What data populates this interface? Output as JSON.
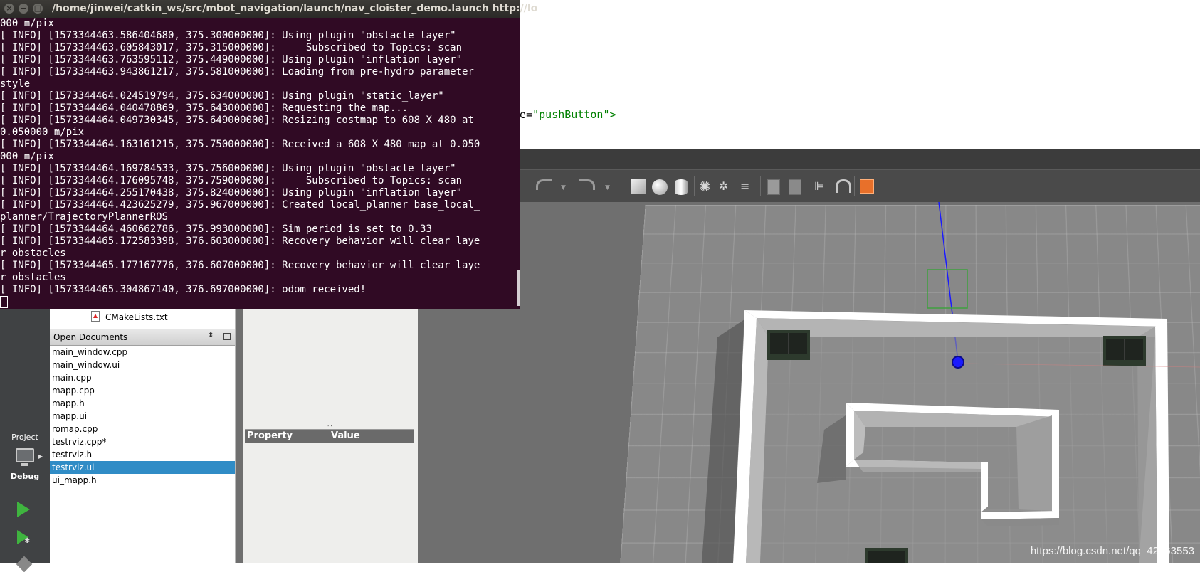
{
  "editor": {
    "code_fragment_attr": "ame=",
    "code_fragment_value": "\"pushButton\">"
  },
  "terminal": {
    "title": "/home/jinwei/catkin_ws/src/mbot_navigation/launch/nav_cloister_demo.launch http://lo",
    "buttons": [
      "×",
      "−",
      "□"
    ],
    "lines": [
      "000 m/pix",
      "[ INFO] [1573344463.586404680, 375.300000000]: Using plugin \"obstacle_layer\"",
      "[ INFO] [1573344463.605843017, 375.315000000]:     Subscribed to Topics: scan",
      "[ INFO] [1573344463.763595112, 375.449000000]: Using plugin \"inflation_layer\"",
      "[ INFO] [1573344463.943861217, 375.581000000]: Loading from pre-hydro parameter",
      "style",
      "[ INFO] [1573344464.024519794, 375.634000000]: Using plugin \"static_layer\"",
      "[ INFO] [1573344464.040478869, 375.643000000]: Requesting the map...",
      "[ INFO] [1573344464.049730345, 375.649000000]: Resizing costmap to 608 X 480 at",
      "0.050000 m/pix",
      "[ INFO] [1573344464.163161215, 375.750000000]: Received a 608 X 480 map at 0.050",
      "000 m/pix",
      "[ INFO] [1573344464.169784533, 375.756000000]: Using plugin \"obstacle_layer\"",
      "[ INFO] [1573344464.176095748, 375.759000000]:     Subscribed to Topics: scan",
      "[ INFO] [1573344464.255170438, 375.824000000]: Using plugin \"inflation_layer\"",
      "[ INFO] [1573344464.423625279, 375.967000000]: Created local_planner base_local_",
      "planner/TrajectoryPlannerROS",
      "[ INFO] [1573344464.460662786, 375.993000000]: Sim period is set to 0.33",
      "[ INFO] [1573344465.172583398, 376.603000000]: Recovery behavior will clear laye",
      "r obstacles",
      "[ INFO] [1573344465.177167776, 376.607000000]: Recovery behavior will clear laye",
      "r obstacles",
      "[ INFO] [1573344465.304867140, 376.697000000]: odom received!"
    ]
  },
  "qtcreator": {
    "project_file": "CMakeLists.txt",
    "open_documents_title": "Open Documents",
    "open_documents": [
      {
        "name": "main_window.cpp",
        "selected": false
      },
      {
        "name": "main_window.ui",
        "selected": false
      },
      {
        "name": "main.cpp",
        "selected": false
      },
      {
        "name": "mapp.cpp",
        "selected": false
      },
      {
        "name": "mapp.h",
        "selected": false
      },
      {
        "name": "mapp.ui",
        "selected": false
      },
      {
        "name": "romap.cpp",
        "selected": false
      },
      {
        "name": "testrviz.cpp*",
        "selected": false
      },
      {
        "name": "testrviz.h",
        "selected": false
      },
      {
        "name": "testrviz.ui",
        "selected": true
      },
      {
        "name": "ui_mapp.h",
        "selected": false
      }
    ],
    "modes": {
      "project": "Project",
      "debug": "Debug"
    },
    "property_editor": {
      "property_header": "Property",
      "value_header": "Value",
      "grip": "'''"
    }
  },
  "gazebo": {
    "toolbar": [
      "undo-icon",
      "redo-icon",
      "box-icon",
      "sphere-icon",
      "cylinder-icon",
      "point-light-icon",
      "spot-light-icon",
      "directional-light-icon",
      "copy-icon",
      "paste-icon",
      "align-icon",
      "snap-icon",
      "view-angle-icon"
    ],
    "accent_color": "#e8702a"
  },
  "watermark": "https://blog.csdn.net/qq_42263553"
}
